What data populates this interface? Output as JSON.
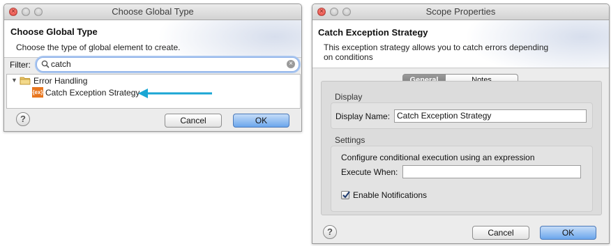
{
  "left_dialog": {
    "window_title": "Choose Global Type",
    "header_title": "Choose Global Type",
    "header_description": "Choose the type of global element to create.",
    "filter_label": "Filter:",
    "filter_value": "catch",
    "tree": {
      "folder_label": "Error Handling",
      "item_label": "Catch Exception Strategy",
      "item_icon_text": "{ex}"
    },
    "cancel_label": "Cancel",
    "ok_label": "OK",
    "help_glyph": "?"
  },
  "right_dialog": {
    "window_title": "Scope Properties",
    "header_title": "Catch Exception Strategy",
    "header_description_line1": "This exception strategy allows you to catch errors depending",
    "header_description_line2": "on conditions",
    "tabs": [
      "General",
      "Notes"
    ],
    "display_section": "Display",
    "display_name_label": "Display Name:",
    "display_name_value": "Catch Exception Strategy",
    "settings_section": "Settings",
    "settings_description": "Configure conditional execution using an expression",
    "execute_when_label": "Execute When:",
    "execute_when_value": "",
    "enable_notifications_label": "Enable Notifications",
    "enable_notifications_checked": true,
    "cancel_label": "Cancel",
    "ok_label": "OK",
    "help_glyph": "?"
  },
  "colors": {
    "arrow": "#1aa6d4",
    "ok_button": "#6ba6ec",
    "icon_orange": "#e8761e",
    "focus_ring": "#7fa9e6"
  }
}
